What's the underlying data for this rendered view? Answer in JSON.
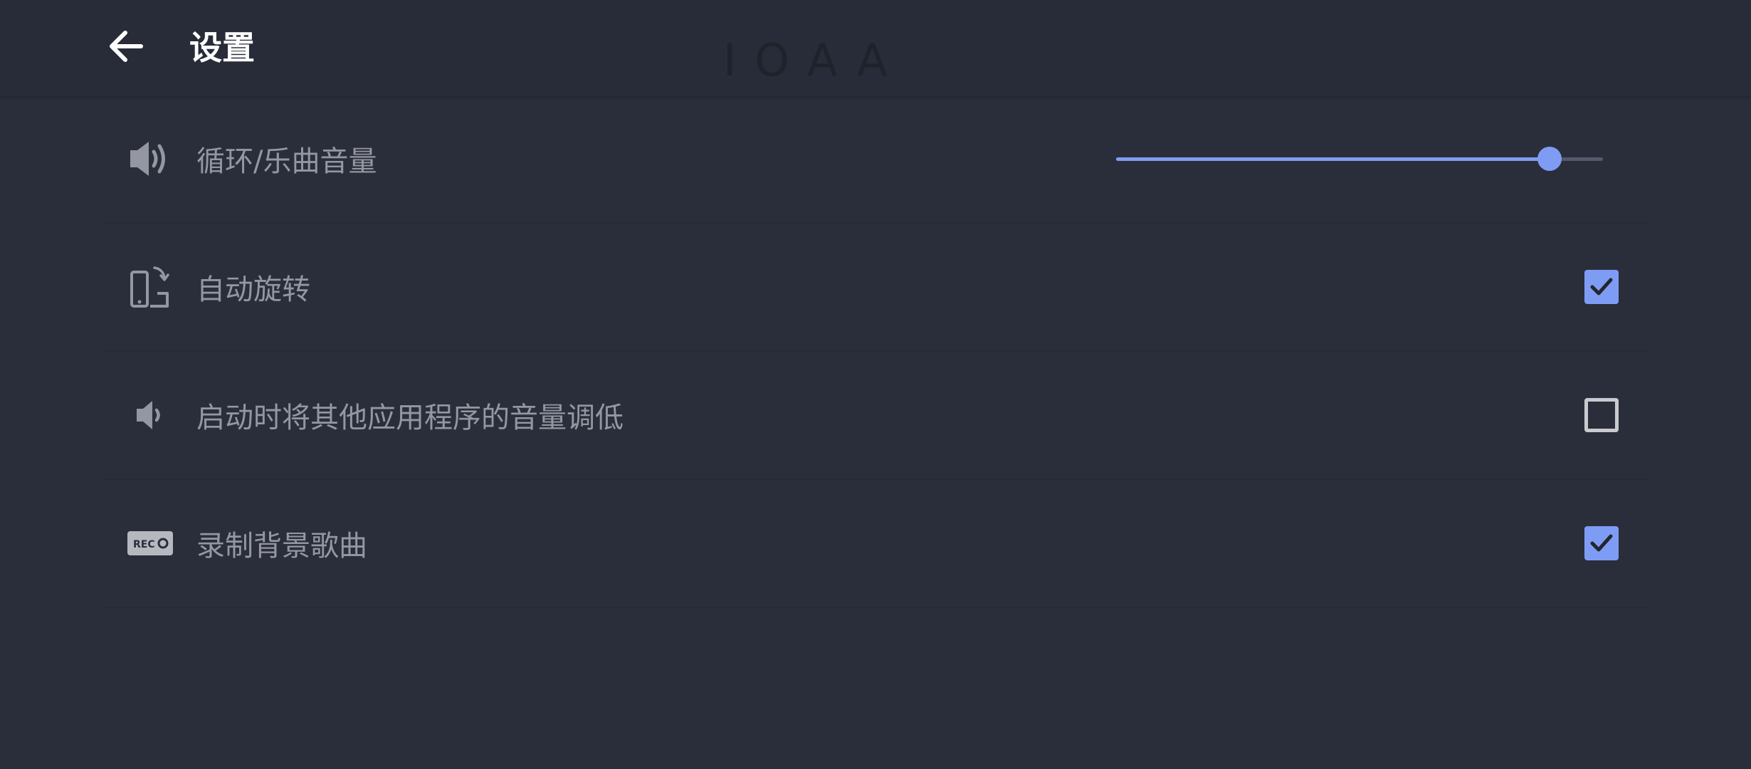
{
  "app_bar": {
    "title": "设置",
    "watermark": "IOAA",
    "back_icon": "arrow-left-icon"
  },
  "settings": [
    {
      "id": "loop-music-volume",
      "icon": "speaker-loud-icon",
      "label": "循环/乐曲音量",
      "control": "slider",
      "value": 0.89
    },
    {
      "id": "auto-rotate",
      "icon": "screen-rotation-icon",
      "label": "自动旋转",
      "control": "checkbox",
      "checked": true
    },
    {
      "id": "lower-other-apps-volume",
      "icon": "speaker-low-icon",
      "label": "启动时将其他应用程序的音量调低",
      "control": "checkbox",
      "checked": false
    },
    {
      "id": "record-background-music",
      "icon": "rec-icon",
      "label": "录制背景歌曲",
      "control": "checkbox",
      "checked": true
    }
  ],
  "colors": {
    "background": "#2a2e3a",
    "accent": "#7f9cf5",
    "label": "#9497a1",
    "title": "#ffffff"
  }
}
